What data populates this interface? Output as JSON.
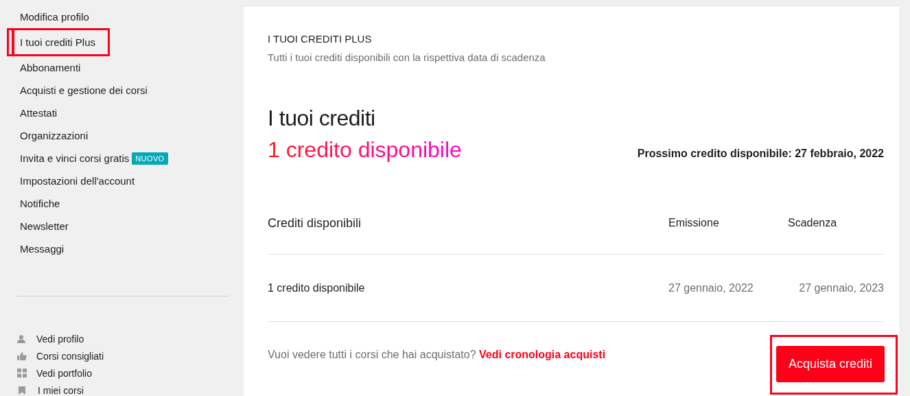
{
  "sidebar": {
    "items": [
      {
        "label": "Modifica profilo",
        "selected": false,
        "annotated": false
      },
      {
        "label": "I tuoi crediti Plus",
        "selected": true,
        "annotated": true
      },
      {
        "label": "Abbonamenti",
        "selected": false,
        "annotated": false
      },
      {
        "label": "Acquisti e gestione dei corsi",
        "selected": false,
        "annotated": false
      },
      {
        "label": "Attestati",
        "selected": false,
        "annotated": false
      },
      {
        "label": "Organizzazioni",
        "selected": false,
        "annotated": false
      },
      {
        "label": "Invita e vinci corsi gratis",
        "badge": "NUOVO",
        "selected": false,
        "annotated": false
      },
      {
        "label": "Impostazioni dell'account",
        "selected": false,
        "annotated": false
      },
      {
        "label": "Notifiche",
        "selected": false,
        "annotated": false
      },
      {
        "label": "Newsletter",
        "selected": false,
        "annotated": false
      },
      {
        "label": "Messaggi",
        "selected": false,
        "annotated": false
      }
    ],
    "links": [
      {
        "kind": "person",
        "label": "Vedi profilo"
      },
      {
        "kind": "thumb",
        "label": "Corsi consigliati"
      },
      {
        "kind": "grid",
        "label": "Vedi portfolio"
      },
      {
        "kind": "bookmark",
        "label": "I miei corsi"
      }
    ]
  },
  "header": {
    "title": "I TUOI CREDITI PLUS",
    "subtitle": "Tutti i tuoi crediti disponibili con la rispettiva data di scadenza"
  },
  "summary": {
    "title": "I tuoi crediti",
    "available": "1 credito disponibile",
    "next": "Prossimo credito disponibile: 27 febbraio, 2022"
  },
  "table": {
    "columns": [
      "Crediti disponibili",
      "Emissione",
      "Scadenza"
    ],
    "rows": [
      [
        "1 credito disponibile",
        "27 gennaio, 2022",
        "27 gennaio, 2023"
      ]
    ]
  },
  "footer": {
    "question": "Vuoi vedere tutti i corsi che hai acquistato?",
    "link": "Vedi cronologia acquisti",
    "button": "Acquista crediti",
    "button_annotated": true
  }
}
